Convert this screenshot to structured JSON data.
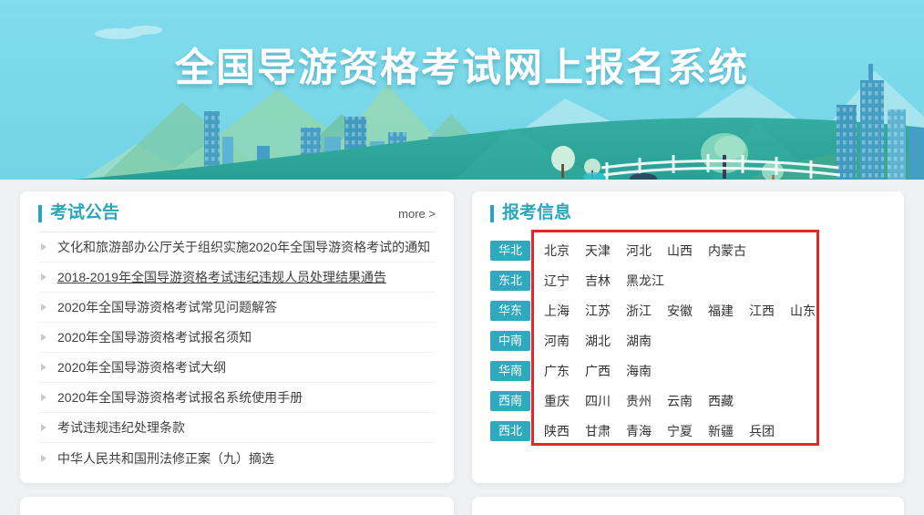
{
  "banner": {
    "title": "全国导游资格考试网上报名系统"
  },
  "announcements": {
    "title": "考试公告",
    "more_label": "more >",
    "items": [
      {
        "text": "文化和旅游部办公厅关于组织实施2020年全国导游资格考试的通知",
        "underlined": false
      },
      {
        "text": "2018-2019年全国导游资格考试违纪违规人员处理结果通告",
        "underlined": true
      },
      {
        "text": "2020年全国导游资格考试常见问题解答",
        "underlined": false
      },
      {
        "text": "2020年全国导游资格考试报名须知",
        "underlined": false
      },
      {
        "text": "2020年全国导游资格考试大纲",
        "underlined": false
      },
      {
        "text": "2020年全国导游资格考试报名系统使用手册",
        "underlined": false
      },
      {
        "text": "考试违规违纪处理条款",
        "underlined": false
      },
      {
        "text": "中华人民共和国刑法修正案（九）摘选",
        "underlined": false
      }
    ]
  },
  "registration": {
    "title": "报考信息",
    "regions": [
      {
        "name": "华北",
        "provinces": [
          "北京",
          "天津",
          "河北",
          "山西",
          "内蒙古"
        ]
      },
      {
        "name": "东北",
        "provinces": [
          "辽宁",
          "吉林",
          "黑龙江"
        ]
      },
      {
        "name": "华东",
        "provinces": [
          "上海",
          "江苏",
          "浙江",
          "安徽",
          "福建",
          "江西",
          "山东"
        ]
      },
      {
        "name": "中南",
        "provinces": [
          "河南",
          "湖北",
          "湖南"
        ]
      },
      {
        "name": "华南",
        "provinces": [
          "广东",
          "广西",
          "海南"
        ]
      },
      {
        "name": "西南",
        "provinces": [
          "重庆",
          "四川",
          "贵州",
          "云南",
          "西藏"
        ]
      },
      {
        "name": "西北",
        "provinces": [
          "陕西",
          "甘肃",
          "青海",
          "宁夏",
          "新疆",
          "兵团"
        ]
      }
    ]
  },
  "colors": {
    "accent": "#2aa6b9",
    "region_button": "#2fa9bd",
    "highlight_border": "#e8262a",
    "banner_top": "#81dcec",
    "banner_bottom": "#72d4e6"
  }
}
